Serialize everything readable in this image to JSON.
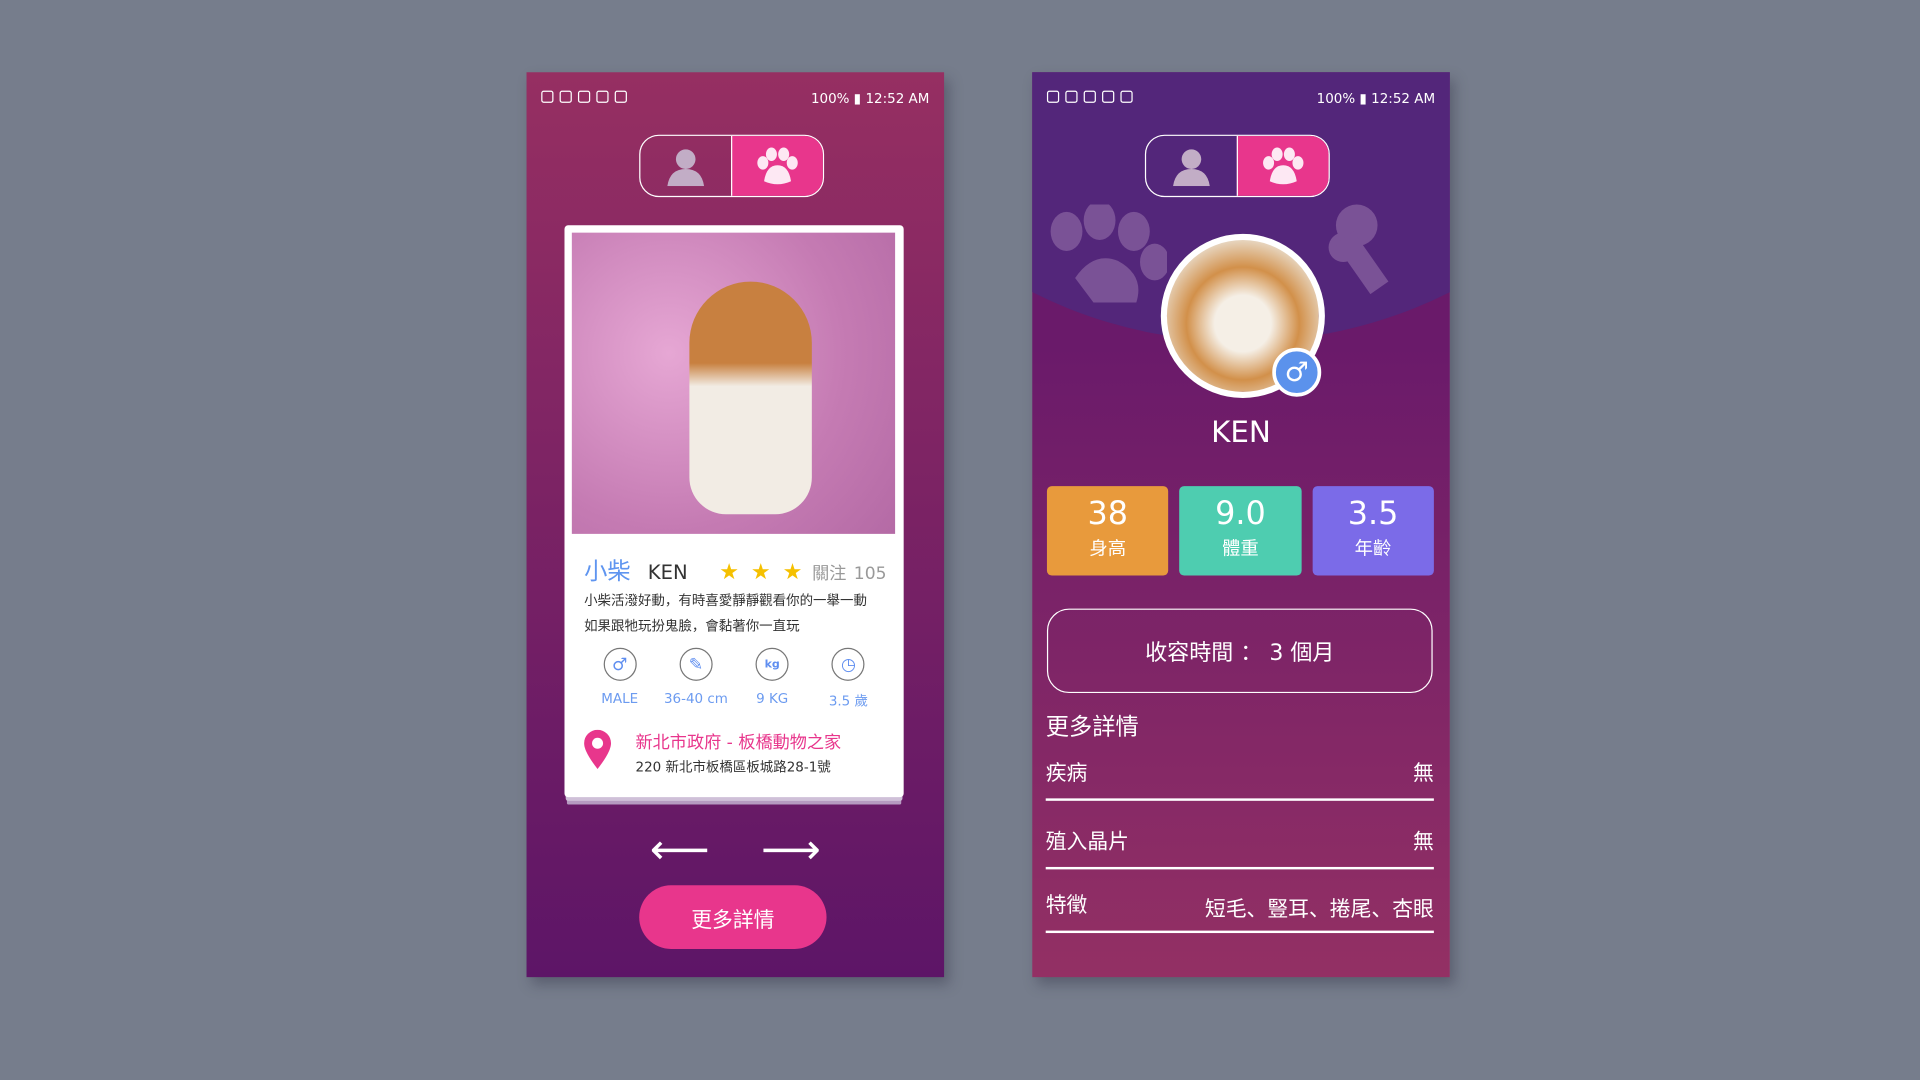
{
  "status_bar": {
    "battery": "100%",
    "time": "12:52 AM"
  },
  "colors": {
    "accent": "#e8368c",
    "blue": "#5f95f0",
    "orange": "#e89a3c",
    "teal": "#4ecdb0",
    "violet": "#7b6be8"
  },
  "left_screen": {
    "breed": "小柴",
    "name": "KEN",
    "rating": 3,
    "stars": "★ ★ ★",
    "follow_label": "關注",
    "follow_count": "105",
    "description": [
      "小柴活潑好動，有時喜愛靜靜觀看你的一舉一動",
      "如果跟牠玩扮鬼臉，會黏著你一直玩"
    ],
    "features": [
      {
        "icon": "male-icon",
        "glyph": "♂",
        "label": "MALE"
      },
      {
        "icon": "ruler-icon",
        "glyph": "✎",
        "label": "36-40 cm"
      },
      {
        "icon": "weight-icon",
        "glyph": "kg",
        "label": "9 KG"
      },
      {
        "icon": "clock-icon",
        "glyph": "◷",
        "label": "3.5 歲"
      }
    ],
    "shelter": "新北市政府 - 板橋動物之家",
    "address": "220 新北市板橋區板城路28-1號",
    "prev": "⟵",
    "next": "⟶",
    "more_button": "更多詳情"
  },
  "right_screen": {
    "name": "KEN",
    "gender_glyph": "♂",
    "stats": [
      {
        "value": "38",
        "label": "身高"
      },
      {
        "value": "9.0",
        "label": "體重"
      },
      {
        "value": "3.5",
        "label": "年齡"
      }
    ],
    "shelter_time": "收容時間 ： 3 個月",
    "more_title": "更多詳情",
    "details": [
      {
        "label": "疾病",
        "value": "無"
      },
      {
        "label": "殖入晶片",
        "value": "無"
      },
      {
        "label": "特徵",
        "value": "短毛、豎耳、捲尾、杏眼"
      }
    ]
  }
}
